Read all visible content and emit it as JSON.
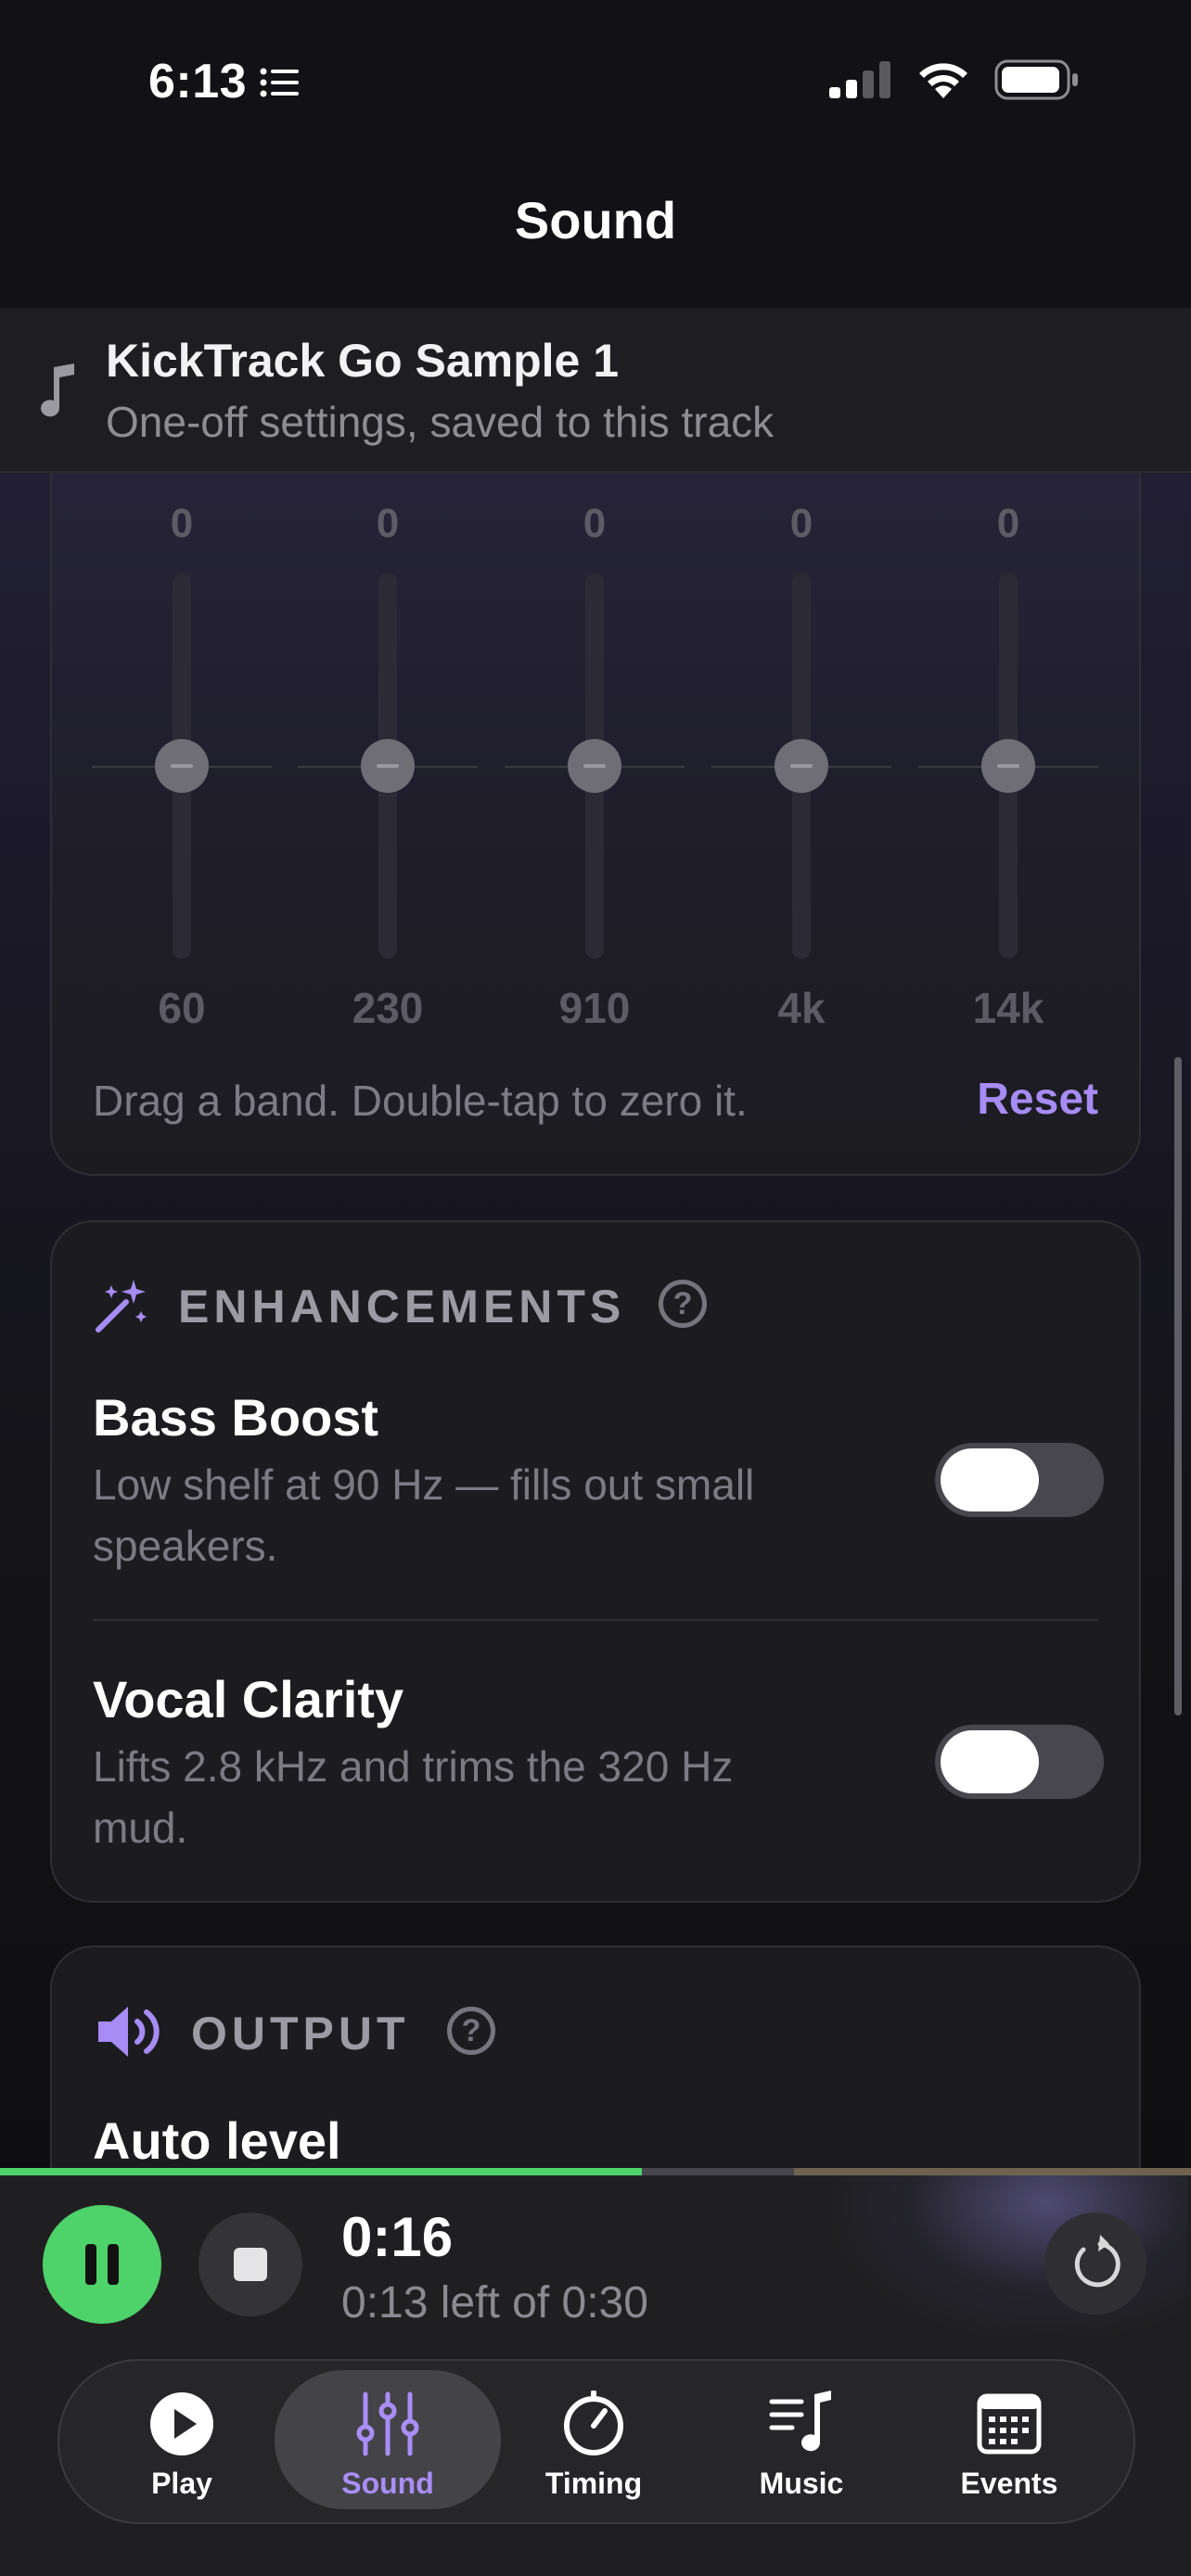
{
  "status_bar": {
    "time": "6:13"
  },
  "header": {
    "title": "Sound"
  },
  "track": {
    "name": "KickTrack Go Sample 1",
    "subtitle": "One-off settings, saved to this track"
  },
  "equalizer": {
    "bands": [
      {
        "value": "0",
        "freq": "60"
      },
      {
        "value": "0",
        "freq": "230"
      },
      {
        "value": "0",
        "freq": "910"
      },
      {
        "value": "0",
        "freq": "4k"
      },
      {
        "value": "0",
        "freq": "14k"
      }
    ],
    "hint": "Drag a band. Double-tap to zero it.",
    "reset_label": "Reset"
  },
  "enhancements": {
    "heading": "ENHANCEMENTS",
    "help": "?",
    "items": [
      {
        "title": "Bass Boost",
        "description": "Low shelf at 90 Hz — fills out small speakers.",
        "enabled": false
      },
      {
        "title": "Vocal Clarity",
        "description": "Lifts 2.8 kHz and trims the 320 Hz mud.",
        "enabled": false
      }
    ]
  },
  "output": {
    "heading": "OUTPUT",
    "help": "?",
    "first_item": "Auto level"
  },
  "player": {
    "elapsed": "0:16",
    "remaining": "0:13 left of 0:30",
    "progress": 0.55
  },
  "tabs": [
    {
      "label": "Play",
      "icon": "play-circle-icon",
      "active": false
    },
    {
      "label": "Sound",
      "icon": "sliders-icon",
      "active": true
    },
    {
      "label": "Timing",
      "icon": "timer-icon",
      "active": false
    },
    {
      "label": "Music",
      "icon": "music-list-icon",
      "active": false
    },
    {
      "label": "Events",
      "icon": "calendar-icon",
      "active": false
    }
  ],
  "colors": {
    "accent": "#a68cf4",
    "play_green": "#4ed36a",
    "background": "#121216"
  }
}
